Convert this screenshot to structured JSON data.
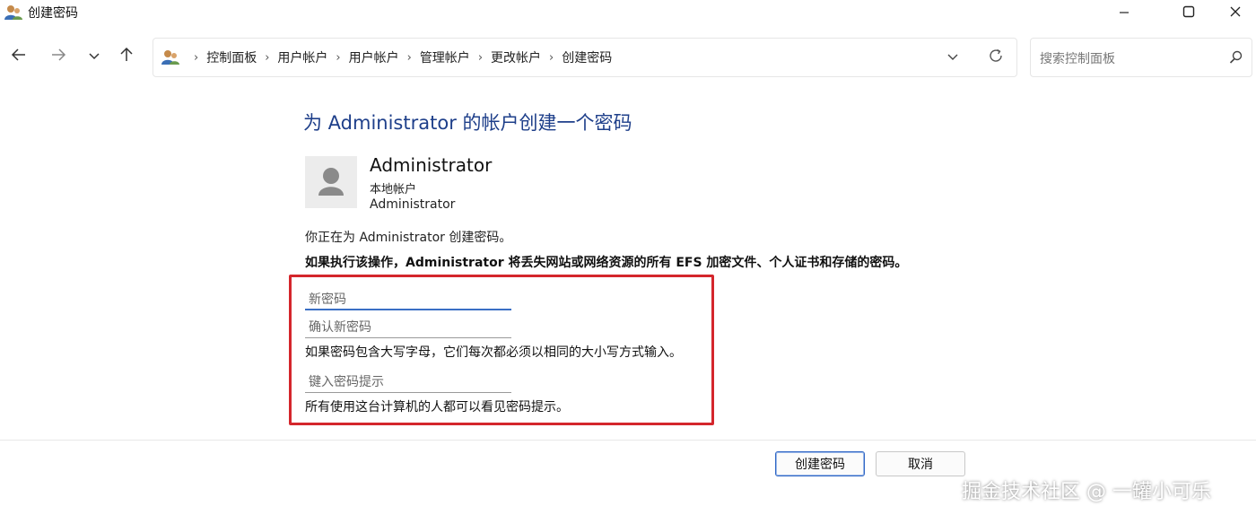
{
  "window": {
    "title": "创建密码",
    "app_icon": "users-icon",
    "controls": [
      "minimize-icon",
      "maximize-icon",
      "close-icon"
    ]
  },
  "nav": {
    "back_icon": "arrow-left-icon",
    "forward_icon": "arrow-right-icon",
    "recent_icon": "chevron-down-icon",
    "up_icon": "arrow-up-icon"
  },
  "address_bar": {
    "location_icon": "users-icon",
    "breadcrumbs": [
      "控制面板",
      "用户帐户",
      "用户帐户",
      "管理帐户",
      "更改帐户",
      "创建密码"
    ],
    "separator": "›"
  },
  "search": {
    "placeholder": "搜索控制面板"
  },
  "main": {
    "title": "为 Administrator 的帐户创建一个密码",
    "account": {
      "name": "Administrator",
      "type": "本地帐户",
      "group": "Administrator"
    },
    "info_text": "你正在为 Administrator 创建密码。",
    "warning_text": "如果执行该操作，Administrator 将丢失网站或网络资源的所有 EFS 加密文件、个人证书和存储的密码。",
    "form": {
      "new_password_placeholder": "新密码",
      "confirm_password_placeholder": "确认新密码",
      "case_note": "如果密码包含大写字母，它们每次都必须以相同的大小写方式输入。",
      "hint_placeholder": "键入密码提示",
      "hint_note": "所有使用这台计算机的人都可以看见密码提示。"
    }
  },
  "buttons": {
    "create": "创建密码",
    "cancel": "取消"
  },
  "watermark": "掘金技术社区 @ 一罐小可乐",
  "colors": {
    "title_blue": "#1e3f8a",
    "highlight_red": "#d4262c",
    "focus_blue": "#3a6fc5"
  }
}
